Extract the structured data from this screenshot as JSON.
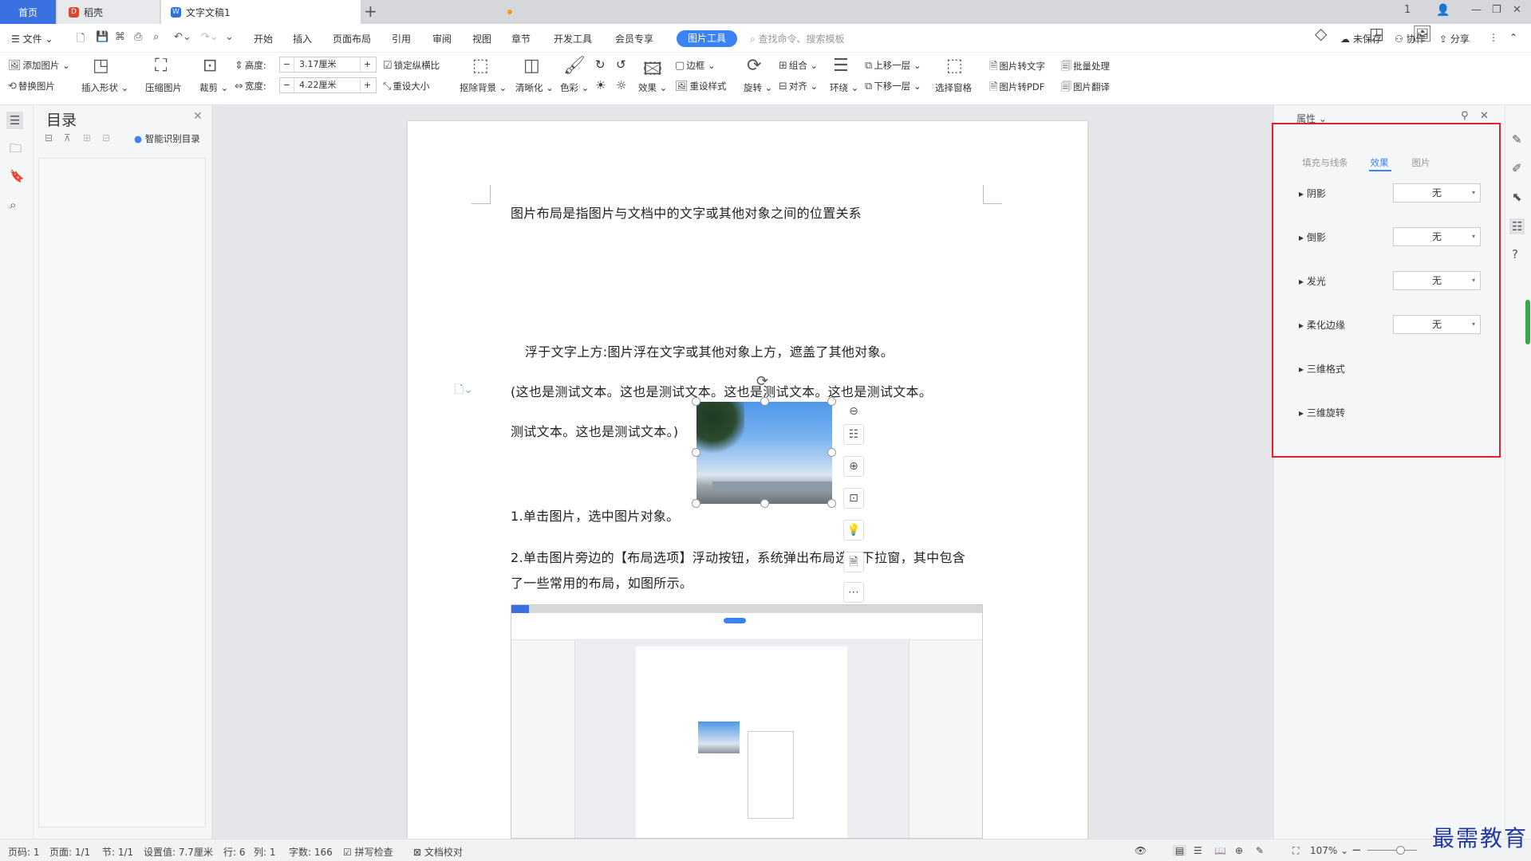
{
  "titlebar": {
    "tabs": [
      {
        "label": "首页"
      },
      {
        "label": "稻壳"
      },
      {
        "label": "文字文稿1"
      }
    ],
    "add_tab": "+",
    "window_controls": [
      "1",
      "—",
      "❐",
      "✕"
    ]
  },
  "menubar": {
    "file": "文件",
    "items": [
      "开始",
      "插入",
      "页面布局",
      "引用",
      "审阅",
      "视图",
      "章节",
      "开发工具",
      "会员专享"
    ],
    "active_tab": "图片工具",
    "search_placeholder": "查找命令、搜索模板",
    "unsaved": "未保存",
    "collab": "协作",
    "share": "分享"
  },
  "ribbon": {
    "add_picture": "添加图片",
    "replace_picture": "替换图片",
    "insert_shape": "插入形状",
    "compress": "压缩图片",
    "crop": "裁剪",
    "height_label": "高度:",
    "height_value": "3.17厘米",
    "width_label": "宽度:",
    "width_value": "4.22厘米",
    "lock_ratio": "锁定纵横比",
    "reset_size": "重设大小",
    "remove_bg": "抠除背景",
    "sharpen": "清晰化",
    "color": "色彩",
    "effect": "效果",
    "border": "边框",
    "reset_style": "重设样式",
    "rotate": "旋转",
    "group": "组合",
    "align": "对齐",
    "wrap": "环绕",
    "bring_forward": "上移一层",
    "send_backward": "下移一层",
    "select_pane": "选择窗格",
    "pic_to_text": "图片转文字",
    "batch": "批量处理",
    "pic_to_pdf": "图片转PDF",
    "pic_translate": "图片翻译"
  },
  "toc": {
    "title": "目录",
    "smart": "智能识别目录"
  },
  "document": {
    "line1": "图片布局是指图片与文档中的文字或其他对象之间的位置关系",
    "line2": "浮于文字上方:图片浮在文字或其他对象上方，遮盖了其他对象。",
    "line3": "(这也是测试文本。这也是测试文本。这也是测试文本。这也是测试文本。",
    "line4": "测试文本。这也是测试文本。)",
    "line5": "1.单击图片，选中图片对象。",
    "line6": "2.单击图片旁边的【布局选项】浮动按钮，系统弹出布局选项下拉窗，其中包含",
    "line7": "了一些常用的布局，如图所示。"
  },
  "properties": {
    "title": "属性",
    "tabs": [
      "填充与线条",
      "效果",
      "图片"
    ],
    "active_tab": "效果",
    "rows": [
      {
        "label": "阴影",
        "value": "无"
      },
      {
        "label": "倒影",
        "value": "无"
      },
      {
        "label": "发光",
        "value": "无"
      },
      {
        "label": "柔化边缘",
        "value": "无"
      },
      {
        "label": "三维格式",
        "value": ""
      },
      {
        "label": "三维旋转",
        "value": ""
      }
    ]
  },
  "statusbar": {
    "page_num": "页码: 1",
    "page": "页面: 1/1",
    "section": "节: 1/1",
    "setting": "设置值: 7.7厘米",
    "row": "行: 6",
    "col": "列: 1",
    "words": "字数: 166",
    "spell": "拼写检查",
    "proof": "文档校对",
    "zoom": "107%"
  },
  "watermark": "最需教育",
  "colors": {
    "accent": "#3b82f6",
    "highlight_box": "#e0202b"
  }
}
